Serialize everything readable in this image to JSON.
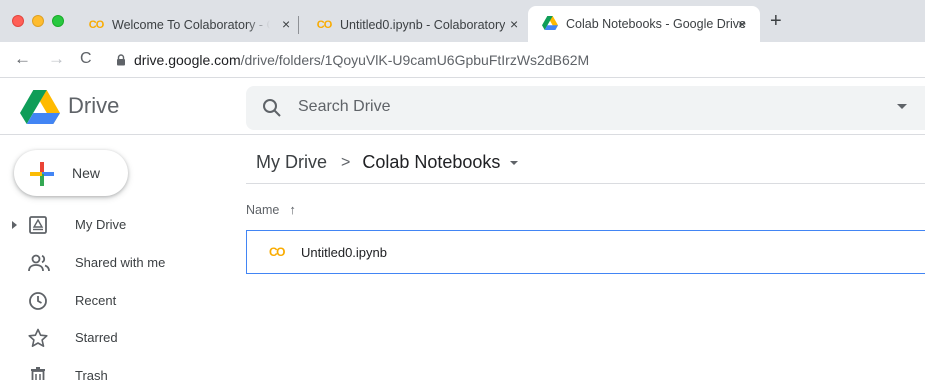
{
  "browser": {
    "tabs": [
      {
        "title": "Welcome To Colaboratory - Colab",
        "close": "×",
        "favicon": "colab-icon"
      },
      {
        "title": "Untitled0.ipynb - Colaboratory",
        "close": "×",
        "favicon": "colab-icon"
      },
      {
        "title": "Colab Notebooks - Google Drive",
        "close": "×",
        "favicon": "drive-icon",
        "active": true
      }
    ],
    "new_tab": "+",
    "url_host": "drive.google.com",
    "url_path": "/drive/folders/1QoyuVlK-U9camU6GpbuFtIrzWs2dB62M"
  },
  "drive": {
    "brand": "Drive",
    "search_placeholder": "Search Drive",
    "new_button": "New",
    "nav": [
      {
        "label": "My Drive",
        "icon": "my-drive-icon"
      },
      {
        "label": "Shared with me",
        "icon": "shared-icon"
      },
      {
        "label": "Recent",
        "icon": "clock-icon"
      },
      {
        "label": "Starred",
        "icon": "star-icon"
      },
      {
        "label": "Trash",
        "icon": "trash-icon"
      }
    ],
    "breadcrumb": {
      "root": "My Drive",
      "separator": ">",
      "current": "Colab Notebooks"
    },
    "column_header": {
      "name": "Name",
      "sort_arrow": "↑"
    },
    "files": [
      {
        "name": "Untitled0.ipynb",
        "icon": "colab-file-icon"
      }
    ]
  },
  "colors": {
    "accent": "#4285f4",
    "colab": "#f9ab00",
    "chrome_tabstrip": "#dee1e6",
    "search_bg": "#f1f3f4"
  }
}
